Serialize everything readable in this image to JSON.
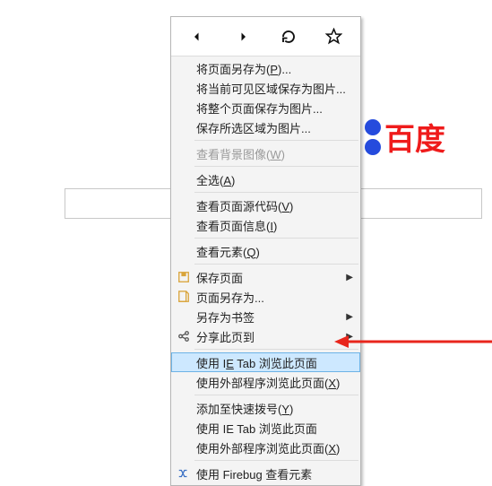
{
  "background": {
    "logo_text": "百度"
  },
  "nav": {
    "back": "back-icon",
    "forward": "forward-icon",
    "reload": "reload-icon",
    "bookmark": "star-icon"
  },
  "menu": {
    "save_page_as": "将页面另存为(",
    "save_page_as_k": "P",
    "save_page_as_t": ")...",
    "save_visible_as_image": "将当前可见区域保存为图片...",
    "save_whole_as_image": "将整个页面保存为图片...",
    "save_selection_as_image": "保存所选区域为图片...",
    "view_bg_image": "查看背景图像(",
    "view_bg_image_k": "W",
    "view_bg_image_t": ")",
    "select_all": "全选(",
    "select_all_k": "A",
    "select_all_t": ")",
    "view_source": "查看页面源代码(",
    "view_source_k": "V",
    "view_source_t": ")",
    "view_page_info": "查看页面信息(",
    "view_page_info_k": "I",
    "view_page_info_t": ")",
    "inspect_element": "查看元素(",
    "inspect_element_k": "Q",
    "inspect_element_t": ")",
    "save_page": "保存页面",
    "page_save_as": "页面另存为...",
    "save_as_bookmark": "另存为书签",
    "share_page": "分享此页到",
    "use_ie_tab": "使用 I",
    "use_ie_tab_k": "E",
    "use_ie_tab_t": " Tab 浏览此页面",
    "use_external": "使用外部程序浏览此页面(",
    "use_external_k": "X",
    "use_external_t": ")",
    "add_speed_dial": "添加至快速拨号(",
    "add_speed_dial_k": "Y",
    "add_speed_dial_t": ")",
    "use_ie_tab2": "使用 IE Tab 浏览此页面",
    "use_external2": "使用外部程序浏览此页面(",
    "use_external2_k": "X",
    "use_external2_t": ")",
    "use_firebug": "使用 Firebug 查看元素"
  }
}
